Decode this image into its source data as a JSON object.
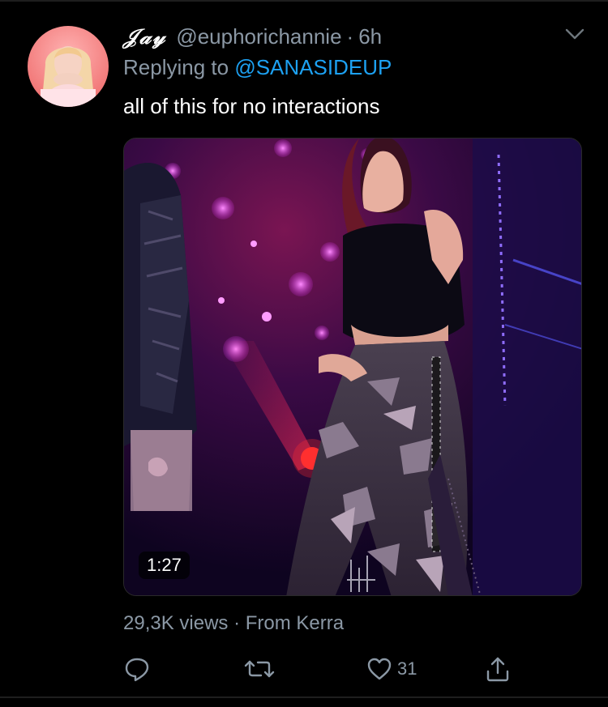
{
  "tweet": {
    "display_name": "𝒥𝒶𝓎",
    "handle": "@euphorichannie",
    "separator": "·",
    "time_ago": "6h",
    "replying_prefix": "Replying to",
    "replying_handle": "@SANASIDEUP",
    "text": "all of this for no interactions"
  },
  "media": {
    "type": "video",
    "duration": "1:27"
  },
  "meta": {
    "views": "29,3K views",
    "separator": "·",
    "source": "From Kerra"
  },
  "actions": {
    "reply_icon": "reply-icon",
    "retweet_icon": "retweet-icon",
    "like_icon": "heart-icon",
    "like_count": "31",
    "share_icon": "share-icon"
  },
  "colors": {
    "background": "#000000",
    "secondary_text": "#8b98a5",
    "link": "#1da1f2"
  }
}
